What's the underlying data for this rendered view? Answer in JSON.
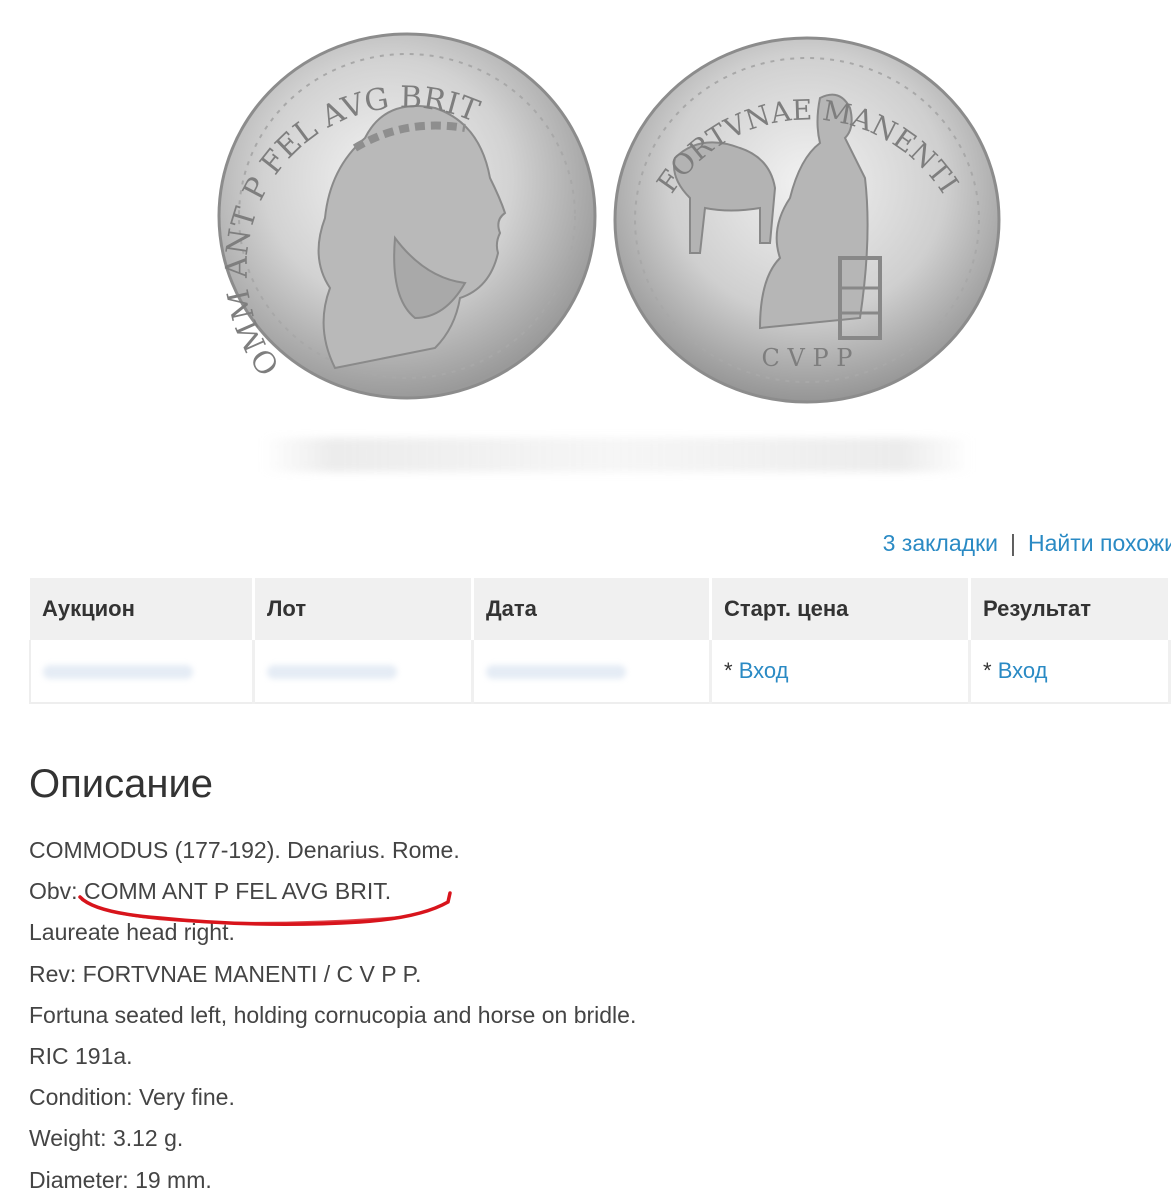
{
  "links": {
    "bookmarks": "3 закладки",
    "separator": "|",
    "find_similar": "Найти похожи"
  },
  "table": {
    "headers": [
      "Аукцион",
      "Лот",
      "Дата",
      "Старт. цена",
      "Результат"
    ],
    "row": {
      "start_price_prefix": "*",
      "start_price_link": "Вход",
      "result_prefix": "*",
      "result_link": "Вход"
    }
  },
  "description": {
    "title": "Описание",
    "lines": [
      "COMMODUS (177-192). Denarius. Rome.",
      "Obv: COMM ANT P FEL AVG BRIT.",
      "Laureate head right.",
      "Rev: FORTVNAE MANENTI / C V P P.",
      "Fortuna seated left, holding cornucopia and horse on bridle.",
      "RIC 191a.",
      "Condition: Very fine.",
      "Weight: 3.12 g.",
      "Diameter: 19 mm."
    ]
  },
  "coin": {
    "obverse_legend": "COMM ANT P FEL AVG BRIT",
    "reverse_legend": "FORTVNAE MANENTI",
    "reverse_exergue": "C V P P"
  },
  "colors": {
    "link": "#2a8ac4",
    "header_bg": "#f0f0f0",
    "annotation": "#d8141c",
    "coin_silver": "#c9c9c9"
  }
}
